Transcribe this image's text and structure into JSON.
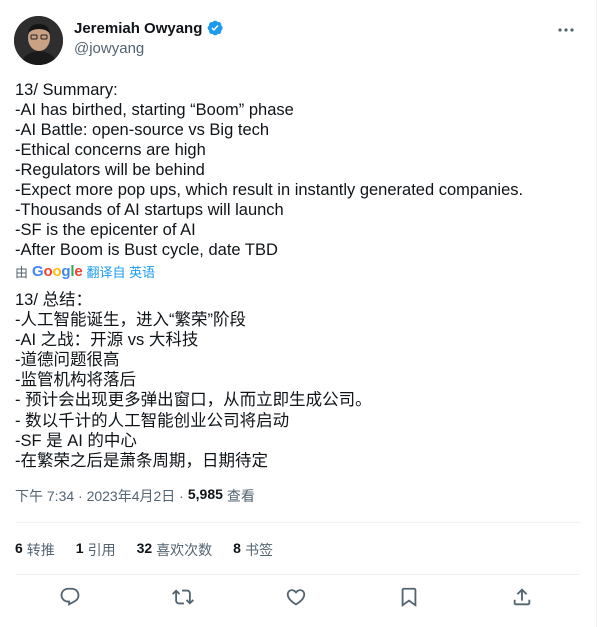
{
  "author": {
    "name": "Jeremiah Owyang",
    "handle": "@jowyang",
    "avatar_icon": "profile-photo",
    "verified_color": "#1d9bf0"
  },
  "tweet": {
    "original_lines": [
      "13/ Summary:",
      "-AI has birthed, starting “Boom” phase",
      "-AI Battle: open-source vs Big tech",
      "-Ethical concerns are high",
      "-Regulators will be behind",
      "-Expect more pop ups, which result in instantly generated companies.",
      "-Thousands of AI startups will launch",
      "-SF is the epicenter of AI",
      "-After Boom is Bust cycle, date TBD"
    ],
    "translation_by": "由",
    "translation_provider": "Google",
    "translation_link": "翻译自 英语",
    "translated_lines": [
      "13/ 总结：",
      "-人工智能诞生，进入“繁荣”阶段",
      "-AI 之战：开源 vs 大科技",
      "-道德问题很高",
      "-监管机构将落后",
      "- 预计会出现更多弹出窗口，从而立即生成公司。",
      "- 数以千计的人工智能创业公司将启动",
      "-SF 是 AI 的中心",
      "-在繁荣之后是萧条周期，日期待定"
    ],
    "timestamp": "下午 7:34 · 2023年4月2日 ·",
    "views_count": "5,985",
    "views_label": "查看"
  },
  "stats": {
    "retweets": {
      "num": "6",
      "label": "转推"
    },
    "quotes": {
      "num": "1",
      "label": "引用"
    },
    "likes": {
      "num": "32",
      "label": "喜欢次数"
    },
    "bookmarks": {
      "num": "8",
      "label": "书签"
    }
  },
  "actions": [
    "reply-icon",
    "retweet-icon",
    "like-icon",
    "bookmark-icon",
    "share-icon"
  ],
  "colors": {
    "text": "#0f1419",
    "secondary": "#536471",
    "accent": "#1d9bf0",
    "divider": "#eff3f4"
  }
}
